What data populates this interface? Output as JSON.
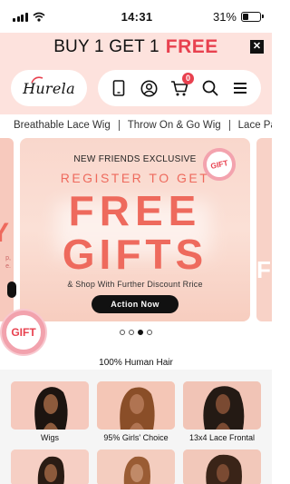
{
  "status_bar": {
    "time": "14:31",
    "battery_percent": "31%",
    "battery_level": 0.31
  },
  "promo": {
    "text": "BUY 1 GET 1",
    "highlight": "FREE",
    "close_icon": "close-icon"
  },
  "header": {
    "logo": "Hurela",
    "icons": [
      "tablet-icon",
      "account-icon",
      "cart-icon",
      "search-icon",
      "menu-icon"
    ],
    "cart_count": "0"
  },
  "categories": [
    "Breathable Lace Wig",
    "Throw On & Go Wig",
    "Lace Part Wig"
  ],
  "banner": {
    "kicker": "NEW FRIENDS EXCLUSIVE",
    "register": "REGISTER TO GET",
    "line1": "FREE",
    "line2": "GIFTS",
    "subtitle": "& Shop With Further Discount Rrice",
    "cta": "Action  Now",
    "badge": "GIFT"
  },
  "floating_gift": "GIFT",
  "carousel": {
    "count": 4,
    "active_index": 2
  },
  "section_title": "100% Human Hair",
  "products": [
    {
      "label": "Wigs"
    },
    {
      "label": "95% Girls' Choice"
    },
    {
      "label": "13x4 Lace Frontal"
    },
    {
      "label": ""
    },
    {
      "label": ""
    },
    {
      "label": ""
    }
  ],
  "colors": {
    "accent": "#e8414f",
    "banner_text": "#ee6a5d",
    "promo_bg": "#fde2dd"
  }
}
